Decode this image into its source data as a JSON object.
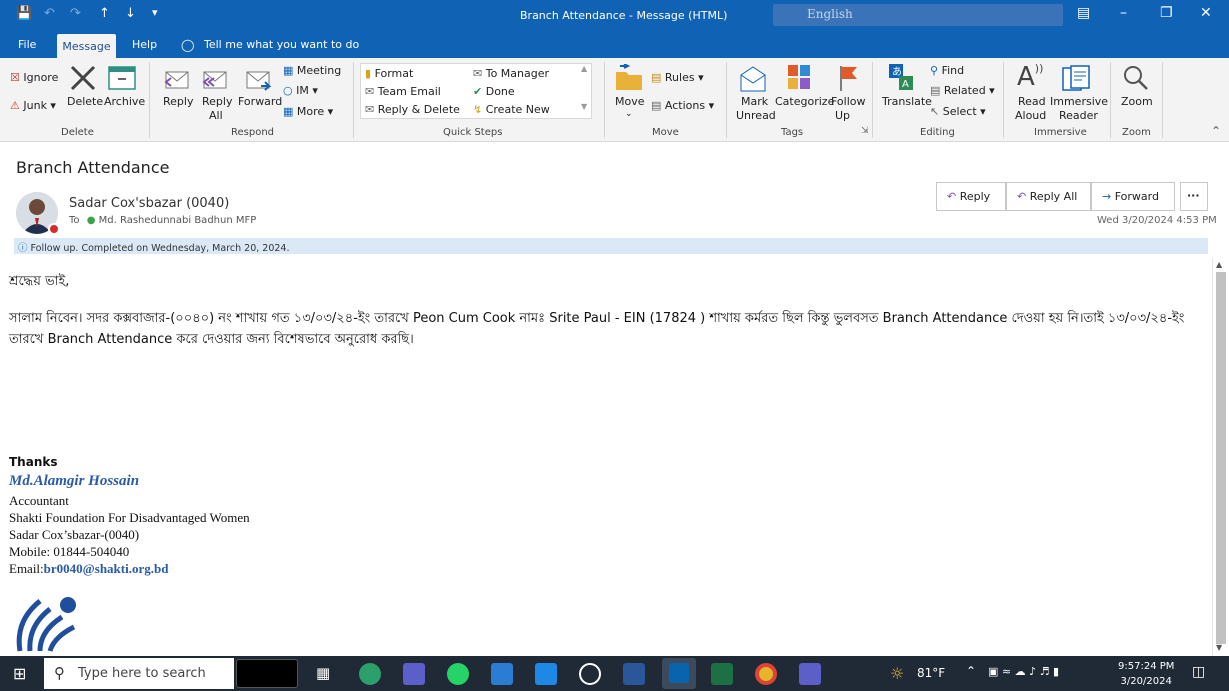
{
  "window": {
    "title": "Branch Attendance  -  Message (HTML)",
    "language_box": "English"
  },
  "menu": {
    "file": "File",
    "message": "Message",
    "help": "Help",
    "tell_me": "Tell me what you want to do"
  },
  "ribbon": {
    "delete_group": {
      "label": "Delete",
      "ignore": "Ignore",
      "junk": "Junk",
      "delete": "Delete",
      "archive": "Archive"
    },
    "respond_group": {
      "label": "Respond",
      "reply": "Reply",
      "reply_all_1": "Reply",
      "reply_all_2": "All",
      "forward": "Forward",
      "meeting": "Meeting",
      "im": "IM",
      "more": "More"
    },
    "quick_steps_group": {
      "label": "Quick Steps",
      "format": "Format",
      "team_email": "Team Email",
      "reply_delete": "Reply & Delete",
      "to_manager": "To Manager",
      "done": "Done",
      "create_new": "Create New"
    },
    "move_group": {
      "label": "Move",
      "move": "Move",
      "rules": "Rules",
      "actions": "Actions"
    },
    "tags_group": {
      "label": "Tags",
      "mark_unread_1": "Mark",
      "mark_unread_2": "Unread",
      "categorize": "Categorize",
      "follow_up_1": "Follow",
      "follow_up_2": "Up"
    },
    "editing_group": {
      "label": "Editing",
      "translate": "Translate",
      "find": "Find",
      "related": "Related",
      "select": "Select"
    },
    "immersive_group": {
      "label": "Immersive",
      "read_aloud_1": "Read",
      "read_aloud_2": "Aloud",
      "immersive_reader_1": "Immersive",
      "immersive_reader_2": "Reader"
    },
    "zoom_group": {
      "label": "Zoom",
      "zoom": "Zoom"
    }
  },
  "message": {
    "subject": "Branch Attendance",
    "sender": "Sadar Cox'sbazar (0040)",
    "to_label": "To",
    "recipient": "Md. Rashedunnabi Badhun MFP",
    "date": "Wed 3/20/2024 4:53 PM",
    "reply": "Reply",
    "reply_all": "Reply All",
    "forward": "Forward",
    "more": "···",
    "info": "Follow up.  Completed on Wednesday, March 20, 2024."
  },
  "body": {
    "greeting": "শ্রদ্ধেয় ভাই,",
    "line1": "সালাম নিবেন। সদর কক্সবাজার-(০০৪০) নং শাখায় গত ১৩/০৩/২৪-ইং তারখে Peon Cum Cook নামঃ Srite Paul - EIN (17824 ) শাখায় কর্মরত ছিল কিন্তু ভুলবসত Branch Attendance দেওয়া হয় নি।তাই ১৩/০৩/২৪-ইং",
    "line2": "তারখে Branch Attendance করে দেওয়ার জন্য বিশেষভাবে অনুরোধ করছি।"
  },
  "signature": {
    "thanks": "Thanks",
    "name": "Md.Alamgir Hossain",
    "role": "Accountant",
    "org": "Shakti Foundation For Disadvantaged Women",
    "branch": "Sadar Cox’sbazar-(0040)",
    "mobile": "Mobile: 01844-504040",
    "email_label": "Email:",
    "email": "br0040@shakti.org.bd"
  },
  "taskbar": {
    "search_placeholder": "Type here to search",
    "temperature": "81°F",
    "time": "9:57:24 PM",
    "date": "3/20/2024"
  },
  "colors": {
    "accent": "#1062b5",
    "taskbar": "#1f2a36",
    "info": "#dae9f5",
    "sig_name": "#2a5aa8"
  }
}
